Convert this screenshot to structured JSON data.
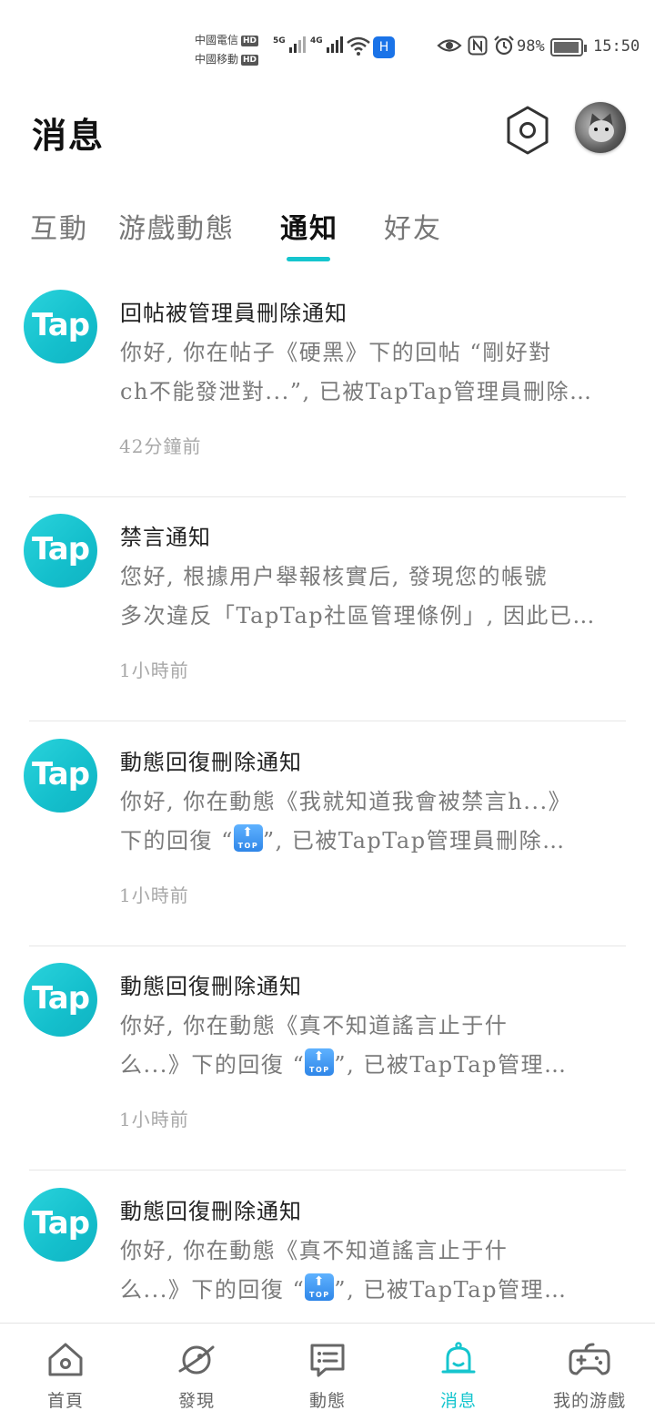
{
  "status_bar": {
    "carrier1": "中國電信",
    "carrier2": "中國移動",
    "hd": "HD",
    "net1": "5G",
    "net2": "4G",
    "battery_pct": "98%",
    "battery_level": 0.98,
    "time": "15:50"
  },
  "header": {
    "title": "消息"
  },
  "tabs": [
    {
      "label": "互動",
      "active": false
    },
    {
      "label": "游戲動態",
      "active": false
    },
    {
      "label": "通知",
      "active": true
    },
    {
      "label": "好友",
      "active": false
    }
  ],
  "notifications": [
    {
      "logo": "Tap",
      "title": "回帖被管理員刪除通知",
      "body_line1": "你好, 你在帖子《硬黑》下的回帖 “剛好對",
      "body_line2": "ch不能發泄對...”, 已被TapTap管理員刪除…",
      "time": "42分鐘前"
    },
    {
      "logo": "Tap",
      "title": "禁言通知",
      "body_line1": "您好, 根據用户舉報核實后, 發現您的帳號",
      "body_line2": "多次違反「TapTap社區管理條例」, 因此已…",
      "time": "1小時前"
    },
    {
      "logo": "Tap",
      "title": "動態回復刪除通知",
      "body_line1": "你好, 你在動態《我就知道我會被禁言h...》",
      "body_line2_pre": "下的回復 “",
      "body_line2_post": "”, 已被TapTap管理員刪除…",
      "time": "1小時前"
    },
    {
      "logo": "Tap",
      "title": "動態回復刪除通知",
      "body_line1": "你好, 你在動態《真不知道謠言止于什",
      "body_line2_pre": "么...》下的回復 “",
      "body_line2_post": "”, 已被TapTap管理…",
      "time": "1小時前"
    },
    {
      "logo": "Tap",
      "title": "動態回復刪除通知",
      "body_line1": "你好, 你在動態《真不知道謠言止于什",
      "body_line2_pre": "么...》下的回復 “",
      "body_line2_post": "”, 已被TapTap管理…",
      "time": ""
    }
  ],
  "top_emoji": {
    "arrow": "⬆",
    "text": "TOP"
  },
  "bottom_nav": [
    {
      "label": "首頁",
      "icon": "home-icon",
      "active": false
    },
    {
      "label": "發現",
      "icon": "planet-icon",
      "active": false
    },
    {
      "label": "動態",
      "icon": "chat-icon",
      "active": false
    },
    {
      "label": "消息",
      "icon": "bell-icon",
      "active": true
    },
    {
      "label": "我的游戲",
      "icon": "gamepad-icon",
      "active": false
    }
  ],
  "colors": {
    "accent": "#15c5ce",
    "tap_logo": "#14bfcc"
  }
}
